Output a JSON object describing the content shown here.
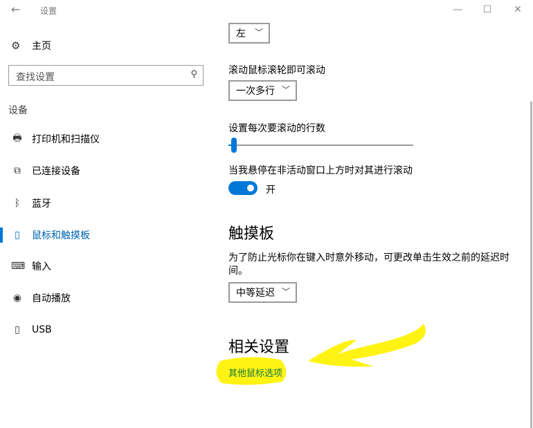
{
  "window": {
    "title": "设置",
    "buttons": {
      "minimize": "—",
      "maximize": "☐",
      "close": "✕"
    }
  },
  "sidebar": {
    "home_label": "主页",
    "search_placeholder": "查找设置",
    "section_title": "设备",
    "items": [
      {
        "label": "打印机和扫描仪",
        "icon": "printer-icon",
        "glyph": "🖶",
        "active": false
      },
      {
        "label": "已连接设备",
        "icon": "connected-devices-icon",
        "glyph": "⧉",
        "active": false
      },
      {
        "label": "蓝牙",
        "icon": "bluetooth-icon",
        "glyph": "ᛒ",
        "active": false
      },
      {
        "label": "鼠标和触摸板",
        "icon": "mouse-icon",
        "glyph": "▯",
        "active": true
      },
      {
        "label": "输入",
        "icon": "keyboard-icon",
        "glyph": "⌨",
        "active": false
      },
      {
        "label": "自动播放",
        "icon": "autoplay-icon",
        "glyph": "◉",
        "active": false
      },
      {
        "label": "USB",
        "icon": "usb-icon",
        "glyph": "▯",
        "active": false
      }
    ]
  },
  "main": {
    "primary_button_select": "左",
    "scroll_wheel_label": "滚动鼠标滚轮即可滚动",
    "scroll_wheel_select": "一次多行",
    "lines_label": "设置每次要滚动的行数",
    "lines_slider_fraction": 0.03,
    "inactive_scroll_label": "当我悬停在非活动窗口上方时对其进行滚动",
    "inactive_scroll_state": "开",
    "touchpad_heading": "触摸板",
    "touchpad_desc": "为了防止光标你在键入时意外移动，可更改单击生效之前的延迟时间。",
    "touchpad_delay_select": "中等延迟",
    "related_heading": "相关设置",
    "related_link": "其他鼠标选项"
  },
  "colors": {
    "accent": "#0078d7",
    "highlight": "#fff200",
    "link": "#0f7a3c"
  }
}
